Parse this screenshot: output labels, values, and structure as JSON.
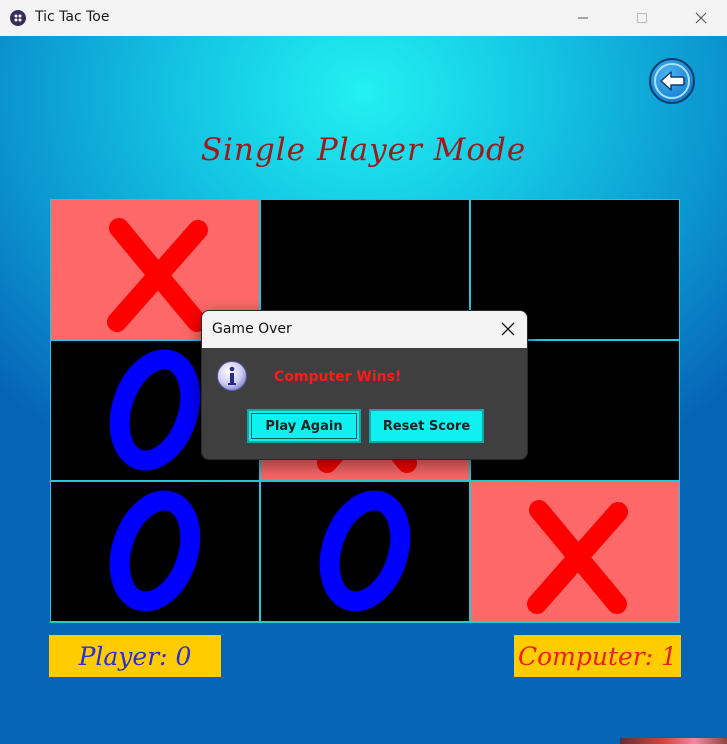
{
  "window": {
    "title": "Tic Tac Toe",
    "icon": "app-icon"
  },
  "controls": {
    "minimize_icon": "minimize-icon",
    "maximize_icon": "maximize-icon",
    "close_icon": "close-icon"
  },
  "back_button": {
    "icon": "arrow-left-icon"
  },
  "game": {
    "mode_title": "Single Player Mode",
    "board": [
      [
        "X",
        "",
        ""
      ],
      [
        "O",
        "X",
        ""
      ],
      [
        "O",
        "O",
        "X"
      ]
    ],
    "winning_cells": [
      [
        0,
        0
      ],
      [
        1,
        1
      ],
      [
        2,
        2
      ]
    ],
    "colors": {
      "x": "#ff0000",
      "o": "#0000ff",
      "cell": "#000000",
      "win_cell": "#ff6868",
      "grid_line": "#1ccbe0",
      "score_bg": "#ffcc00"
    }
  },
  "scores": {
    "player_text": "Player: 0",
    "computer_text": "Computer: 1"
  },
  "dialog": {
    "title": "Game Over",
    "message": "Computer Wins!",
    "icon": "info-icon",
    "play_again_label": "Play Again",
    "reset_score_label": "Reset Score"
  }
}
